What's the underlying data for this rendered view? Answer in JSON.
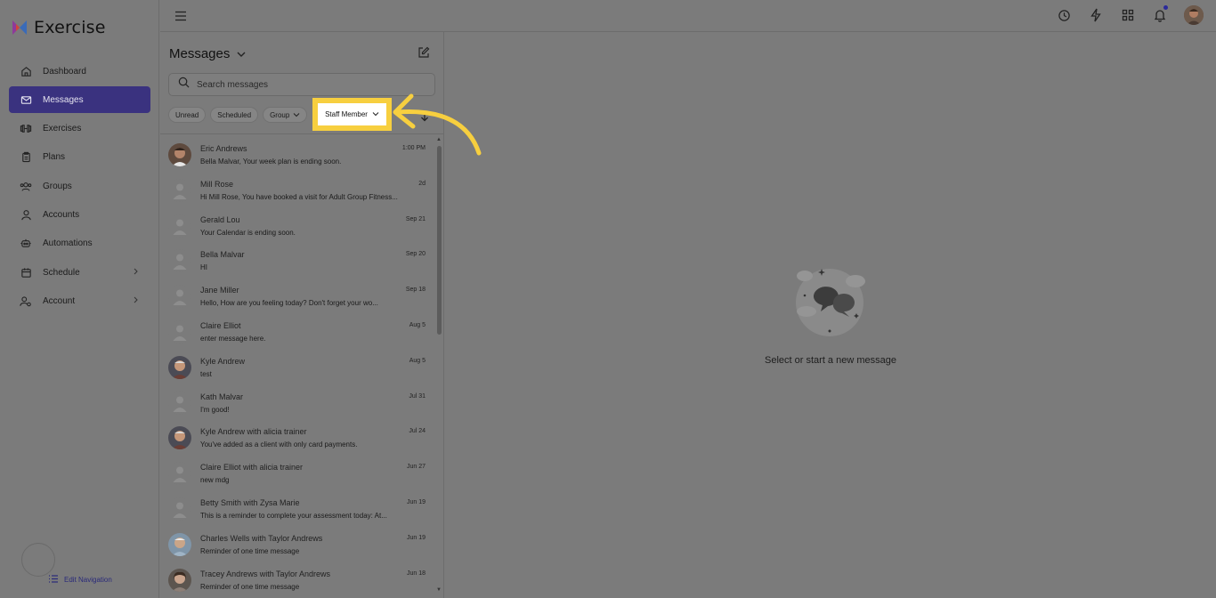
{
  "app": {
    "name": "Exercise"
  },
  "sidebar": {
    "items": [
      {
        "label": "Dashboard",
        "icon": "home-icon",
        "active": false,
        "chevron": false
      },
      {
        "label": "Messages",
        "icon": "mail-icon",
        "active": true,
        "chevron": false
      },
      {
        "label": "Exercises",
        "icon": "dumbbell-icon",
        "active": false,
        "chevron": false
      },
      {
        "label": "Plans",
        "icon": "clipboard-icon",
        "active": false,
        "chevron": false
      },
      {
        "label": "Groups",
        "icon": "users-icon",
        "active": false,
        "chevron": false
      },
      {
        "label": "Accounts",
        "icon": "user-icon",
        "active": false,
        "chevron": false
      },
      {
        "label": "Automations",
        "icon": "robot-icon",
        "active": false,
        "chevron": false
      },
      {
        "label": "Schedule",
        "icon": "calendar-icon",
        "active": false,
        "chevron": true
      },
      {
        "label": "Account",
        "icon": "user-gear-icon",
        "active": false,
        "chevron": true
      }
    ],
    "edit_navigation": "Edit Navigation"
  },
  "messages": {
    "title": "Messages",
    "search_placeholder": "Search messages",
    "filters": {
      "unread": "Unread",
      "scheduled": "Scheduled",
      "group": "Group",
      "staff_member": "Staff Member"
    },
    "conversations": [
      {
        "name": "Eric Andrews",
        "preview": "Bella Malvar, Your week plan is ending soon.",
        "time": "1:00 PM",
        "avatar": "photo-1"
      },
      {
        "name": "Mill Rose",
        "preview": "Hi Mill Rose, You have booked a visit for Adult Group Fitness...",
        "time": "2d",
        "avatar": "placeholder"
      },
      {
        "name": "Gerald Lou",
        "preview": "Your Calendar is ending soon.",
        "time": "Sep 21",
        "avatar": "placeholder"
      },
      {
        "name": "Bella Malvar",
        "preview": "HI",
        "time": "Sep 20",
        "avatar": "placeholder"
      },
      {
        "name": "Jane Miller",
        "preview": "Hello, How are you feeling today? Don't forget your wo...",
        "time": "Sep 18",
        "avatar": "placeholder"
      },
      {
        "name": "Claire Elliot",
        "preview": "enter message here.",
        "time": "Aug 5",
        "avatar": "placeholder"
      },
      {
        "name": "Kyle Andrew",
        "preview": "test",
        "time": "Aug 5",
        "avatar": "photo-2"
      },
      {
        "name": "Kath Malvar",
        "preview": "I'm good!",
        "time": "Jul 31",
        "avatar": "placeholder"
      },
      {
        "name": "Kyle Andrew with alicia trainer",
        "preview": "You've added as a client with only card payments.",
        "time": "Jul 24",
        "avatar": "photo-2"
      },
      {
        "name": "Claire Elliot with alicia trainer",
        "preview": "new mdg",
        "time": "Jun 27",
        "avatar": "placeholder"
      },
      {
        "name": "Betty Smith with Zysa Marie",
        "preview": "This is a reminder to complete your assessment today: At...",
        "time": "Jun 19",
        "avatar": "placeholder"
      },
      {
        "name": "Charles Wells with Taylor Andrews",
        "preview": "Reminder of one time message",
        "time": "Jun 19",
        "avatar": "photo-3"
      },
      {
        "name": "Tracey Andrews with Taylor Andrews",
        "preview": "Reminder of one time message",
        "time": "Jun 18",
        "avatar": "photo-4"
      }
    ]
  },
  "empty_state": {
    "text": "Select or start a new message"
  },
  "colors": {
    "accent": "#3a327f",
    "highlight": "#f7cf3f",
    "notification": "#2b2a9b"
  }
}
